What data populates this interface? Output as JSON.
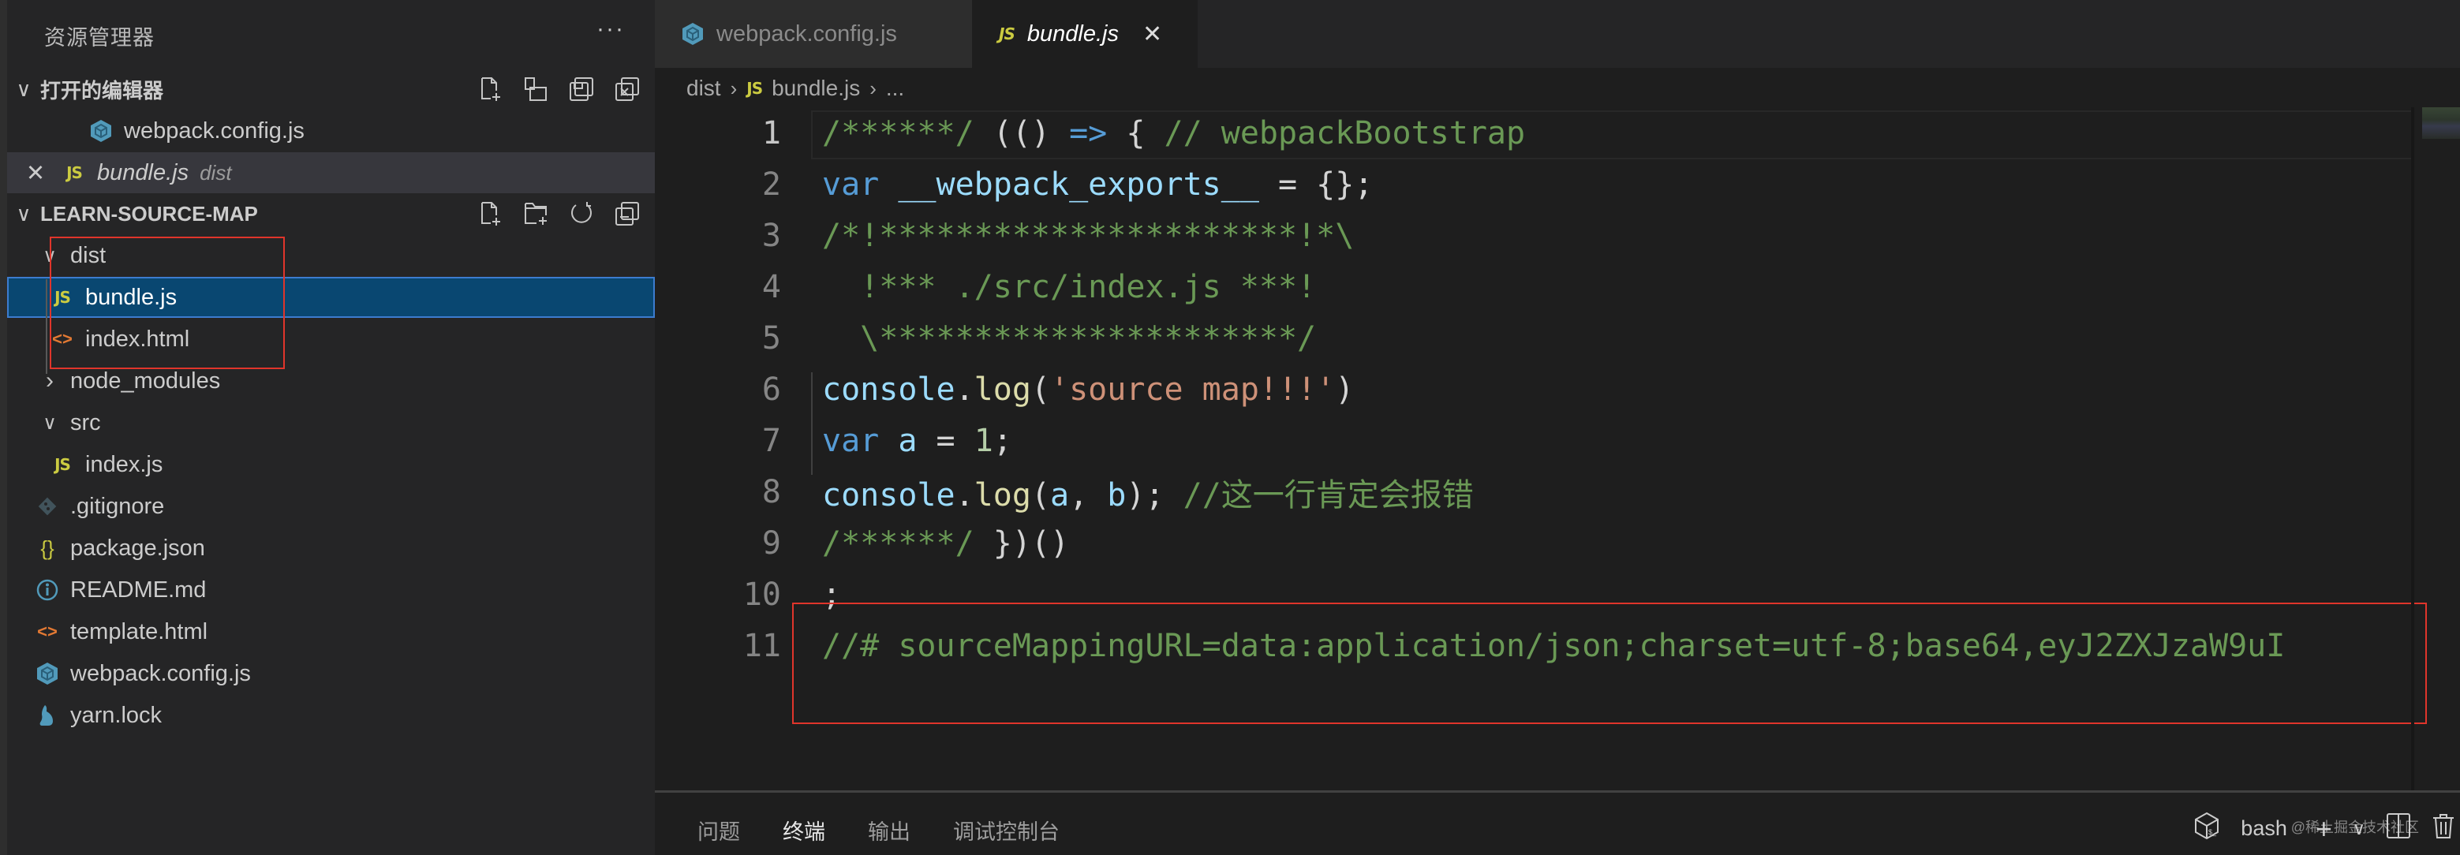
{
  "sidebar": {
    "title": "资源管理器",
    "more_label": "···",
    "open_editors": {
      "label": "打开的编辑器",
      "items": [
        {
          "name": "webpack.config.js",
          "icon": "webpack-icon",
          "description": ""
        },
        {
          "name": "bundle.js",
          "icon": "js-icon",
          "description": "dist",
          "active": true
        }
      ]
    },
    "project": {
      "label": "LEARN-SOURCE-MAP",
      "tree": [
        {
          "name": "dist",
          "type": "folder",
          "expanded": true,
          "depth": 0
        },
        {
          "name": "bundle.js",
          "type": "file",
          "icon": "js-icon",
          "depth": 1,
          "selected": true
        },
        {
          "name": "index.html",
          "type": "file",
          "icon": "html-icon",
          "depth": 1
        },
        {
          "name": "node_modules",
          "type": "folder",
          "expanded": false,
          "depth": 0
        },
        {
          "name": "src",
          "type": "folder",
          "expanded": true,
          "depth": 0
        },
        {
          "name": "index.js",
          "type": "file",
          "icon": "js-icon",
          "depth": 1
        },
        {
          "name": ".gitignore",
          "type": "file",
          "icon": "git-icon",
          "depth": 0
        },
        {
          "name": "package.json",
          "type": "file",
          "icon": "json-icon",
          "depth": 0
        },
        {
          "name": "README.md",
          "type": "file",
          "icon": "info-icon",
          "depth": 0
        },
        {
          "name": "template.html",
          "type": "file",
          "icon": "html-icon",
          "depth": 0
        },
        {
          "name": "webpack.config.js",
          "type": "file",
          "icon": "webpack-icon",
          "depth": 0
        },
        {
          "name": "yarn.lock",
          "type": "file",
          "icon": "yarn-icon",
          "depth": 0
        }
      ]
    }
  },
  "icons": {
    "js": "JS",
    "html": "<>",
    "json": "{}",
    "info": "i",
    "close": "✕",
    "chevron_down": "∨",
    "chevron_right": "›"
  },
  "tabs": [
    {
      "label": "webpack.config.js",
      "icon": "webpack-icon",
      "active": false
    },
    {
      "label": "bundle.js",
      "icon": "js-icon",
      "active": true,
      "close": "✕"
    }
  ],
  "breadcrumb": {
    "items": [
      "dist",
      "bundle.js",
      "..."
    ],
    "separator": "›"
  },
  "code": {
    "lines": [
      {
        "n": "1",
        "tokens": [
          [
            "c-com",
            "/******/"
          ],
          [
            "c-pun",
            " (() "
          ],
          [
            "c-kw",
            "=>"
          ],
          [
            "c-pun",
            " { "
          ],
          [
            "c-com",
            "// webpackBootstrap"
          ]
        ]
      },
      {
        "n": "2",
        "tokens": [
          [
            "c-kw",
            "var"
          ],
          [
            "c-pun",
            " "
          ],
          [
            "c-var",
            "__webpack_exports__"
          ],
          [
            "c-pun",
            " = {};"
          ]
        ]
      },
      {
        "n": "3",
        "tokens": [
          [
            "c-com",
            "/*!**********************!*\\"
          ]
        ]
      },
      {
        "n": "4",
        "tokens": [
          [
            "c-com",
            "  !*** ./src/index.js ***!"
          ]
        ]
      },
      {
        "n": "5",
        "tokens": [
          [
            "c-com",
            "  \\**********************/"
          ]
        ]
      },
      {
        "n": "6",
        "tokens": [
          [
            "c-var",
            "console"
          ],
          [
            "c-pun",
            "."
          ],
          [
            "c-fn",
            "log"
          ],
          [
            "c-pun",
            "("
          ],
          [
            "c-str",
            "'source map!!!'"
          ],
          [
            "c-pun",
            ")"
          ]
        ]
      },
      {
        "n": "7",
        "tokens": [
          [
            "c-kw",
            "var"
          ],
          [
            "c-pun",
            " "
          ],
          [
            "c-var",
            "a"
          ],
          [
            "c-pun",
            " = "
          ],
          [
            "c-num",
            "1"
          ],
          [
            "c-pun",
            ";"
          ]
        ]
      },
      {
        "n": "8",
        "tokens": [
          [
            "c-var",
            "console"
          ],
          [
            "c-pun",
            "."
          ],
          [
            "c-fn",
            "log"
          ],
          [
            "c-pun",
            "("
          ],
          [
            "c-var",
            "a"
          ],
          [
            "c-pun",
            ", "
          ],
          [
            "c-var",
            "b"
          ],
          [
            "c-pun",
            "); "
          ],
          [
            "c-com",
            "//这一行肯定会报错"
          ]
        ]
      },
      {
        "n": "9",
        "tokens": [
          [
            "c-com",
            "/******/"
          ],
          [
            "c-pun",
            " })()"
          ]
        ]
      },
      {
        "n": "10",
        "tokens": [
          [
            "c-pun",
            ";"
          ]
        ]
      },
      {
        "n": "11",
        "tokens": [
          [
            "c-com",
            "//# sourceMappingURL=data:application/json;charset=utf-8;base64,eyJ2ZXJzaW9uI"
          ]
        ]
      }
    ]
  },
  "panel": {
    "tabs": [
      {
        "label": "问题",
        "active": false
      },
      {
        "label": "终端",
        "active": true
      },
      {
        "label": "输出",
        "active": false
      },
      {
        "label": "调试控制台",
        "active": false
      }
    ],
    "terminal_name": "bash",
    "add_label": "+",
    "dropdown": "∨"
  },
  "watermark": "@稀土掘金技术社区",
  "colors": {
    "accent_selection": "#094771",
    "focus_border": "#3c7ccf",
    "annotation_red": "#e0352b",
    "comment": "#6a9955",
    "keyword": "#569cd6"
  }
}
